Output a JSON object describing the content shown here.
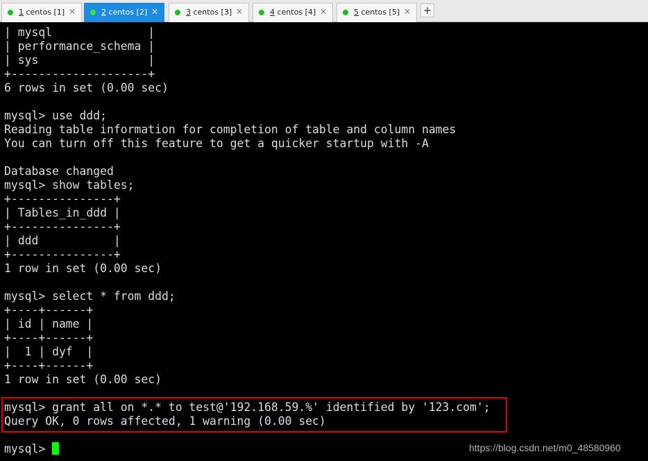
{
  "tabs": [
    {
      "num": "1",
      "name": " centos [1]",
      "active": false
    },
    {
      "num": "2",
      "name": " centos [2]",
      "active": true
    },
    {
      "num": "3",
      "name": " centos [3]",
      "active": false
    },
    {
      "num": "4",
      "name": " centos [4]",
      "active": false
    },
    {
      "num": "5",
      "name": " centos [5]",
      "active": false
    }
  ],
  "tab_close_glyph": "✕",
  "add_tab_glyph": "+",
  "terminal": {
    "lines": [
      "| mysql              |",
      "| performance_schema |",
      "| sys                |",
      "+--------------------+",
      "6 rows in set (0.00 sec)",
      "",
      "mysql> use ddd;",
      "Reading table information for completion of table and column names",
      "You can turn off this feature to get a quicker startup with -A",
      "",
      "Database changed",
      "mysql> show tables;",
      "+---------------+",
      "| Tables_in_ddd |",
      "+---------------+",
      "| ddd           |",
      "+---------------+",
      "1 row in set (0.00 sec)",
      "",
      "mysql> select * from ddd;",
      "+----+------+",
      "| id | name |",
      "+----+------+",
      "|  1 | dyf  |",
      "+----+------+",
      "1 row in set (0.00 sec)",
      "",
      "mysql> grant all on *.* to test@'192.168.59.%' identified by '123.com';",
      "Query OK, 0 rows affected, 1 warning (0.00 sec)",
      ""
    ],
    "prompt": "mysql> "
  },
  "watermark": "https://blog.csdn.net/m0_48580960",
  "colors": {
    "terminal_bg": "#000000",
    "terminal_fg": "#dcdcdc",
    "cursor": "#00ff00",
    "active_tab": "#1e8ae0",
    "highlight_border": "#e00000"
  }
}
